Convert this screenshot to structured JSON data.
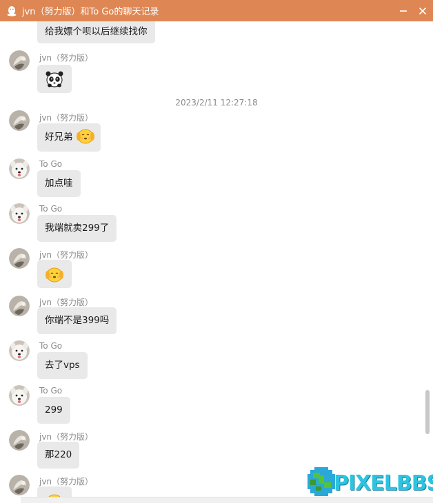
{
  "window": {
    "title": "jvn（努力版）和To Go的聊天记录",
    "minimize_label": "—",
    "close_label": "✕"
  },
  "colors": {
    "titlebar": "#df8754",
    "bubble": "#e9e9e9",
    "watermark": "#2cc4e0"
  },
  "messages": [
    {
      "sender": "",
      "text": "给我嫖个呗以后继续找你",
      "avatar": "jvn-avatar",
      "emoji": null
    },
    {
      "sender": "jvn（努力版）",
      "text": "",
      "avatar": "jvn-avatar",
      "emoji": "panda-emoji"
    },
    {
      "timestamp": "2023/2/11 12:27:18"
    },
    {
      "sender": "jvn（努力版）",
      "text": "好兄弟",
      "avatar": "jvn-avatar",
      "emoji": "dog-emoji"
    },
    {
      "sender": "To Go",
      "text": "加点哇",
      "avatar": "dog-avatar",
      "emoji": null
    },
    {
      "sender": "To Go",
      "text": "我端就卖299了",
      "avatar": "dog-avatar",
      "emoji": null
    },
    {
      "sender": "jvn（努力版）",
      "text": "",
      "avatar": "jvn-avatar",
      "emoji": "dog-emoji"
    },
    {
      "sender": "jvn（努力版）",
      "text": "你端不是399吗",
      "avatar": "jvn-avatar",
      "emoji": null
    },
    {
      "sender": "To Go",
      "text": "去了vps",
      "avatar": "dog-avatar",
      "emoji": null
    },
    {
      "sender": "To Go",
      "text": "299",
      "avatar": "dog-avatar",
      "emoji": null
    },
    {
      "sender": "jvn（努力版）",
      "text": "那220",
      "avatar": "jvn-avatar",
      "emoji": null
    },
    {
      "sender": "jvn（努力版）",
      "text": "",
      "avatar": "jvn-avatar",
      "emoji": "dog-emoji"
    }
  ],
  "watermark": {
    "text": "PIXELBBS"
  }
}
